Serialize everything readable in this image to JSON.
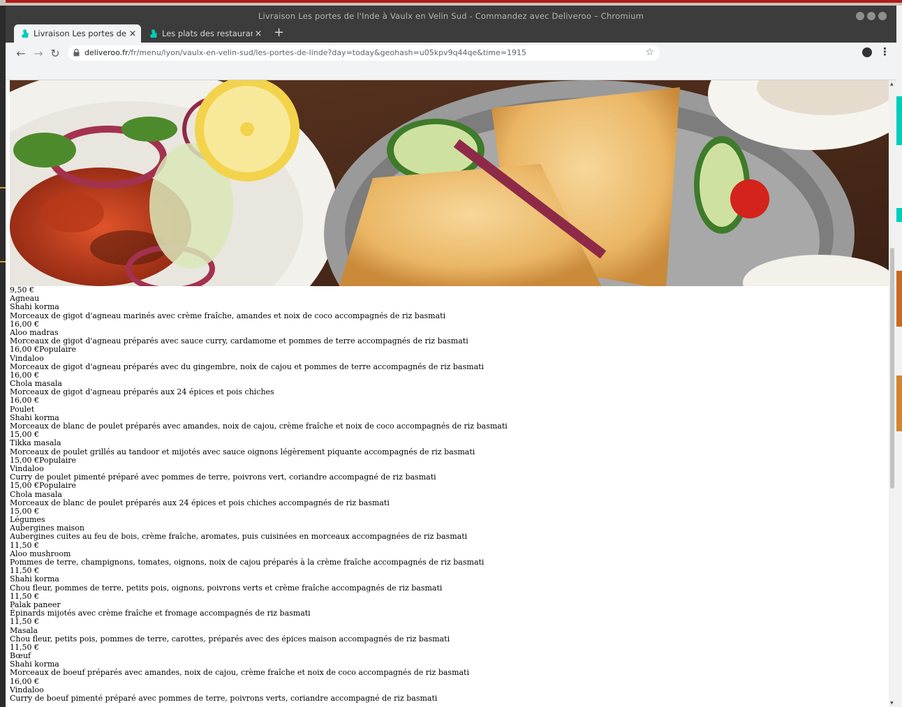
{
  "window": {
    "title": "Livraison Les portes de l'Inde à Vaulx en Velin Sud - Commandez avec Deliveroo – Chromium"
  },
  "tabs": [
    {
      "label": "Livraison Les portes de l'I",
      "close": "×"
    },
    {
      "label": "Les plats des restaurants",
      "close": "×"
    }
  ],
  "newtab_label": "+",
  "address": {
    "url_host": "deliveroo.fr",
    "url_path": "/fr/menu/lyon/vaulx-en-velin-sud/les-portes-de-linde?day=today&geohash=u05kpv9q44qe&time=1915"
  },
  "icons": {
    "back": "arrow-left-icon",
    "forward": "arrow-right-icon",
    "reload": "reload-icon",
    "lock": "lock-icon",
    "star": "star-icon",
    "account": "account-icon",
    "menu": "kebab-menu-icon",
    "favicon": "deliveroo-kangaroo-icon"
  },
  "colors": {
    "deliveroo_teal": "#00ccbc",
    "titlebar": "#3c3c3c",
    "toolbar": "#f1f3f4"
  },
  "menu_lines": [
    "9,50 €",
    "Agneau",
    "Shahi korma",
    "Morceaux de gigot d'agneau marinés avec crème fraîche, amandes et noix de coco accompagnés de riz basmati",
    "16,00 €",
    "Aloo madras",
    "Morceaux de gigot d'agneau préparés avec sauce curry, cardamome et pommes de terre accompagnés de riz basmati",
    "16,00 €Populaire",
    "Vindaloo",
    "Morceaux de gigot d'agneau préparés avec du gingembre, noix de cajou et pommes de terre accompagnés de riz basmati",
    "16,00 €",
    "Chola masala",
    "Morceaux de gigot d'agneau préparés aux 24 épices et pois chiches",
    "16,00 €",
    "Poulet",
    "Shahi korma",
    "Morceaux de blanc de poulet préparés avec amandes, noix de cajou, crème fraîche et noix de coco accompagnés de riz basmati",
    "15,00 €",
    "Tikka masala",
    "Morceaux de poulet grillés au tandoor et mijotés avec sauce oignons légèrement piquante accompagnés de riz basmati",
    "15,00 €Populaire",
    "Vindaloo",
    "Curry de poulet pimenté préparé avec pommes de terre, poivrons vert, coriandre accompagné de riz basmati",
    "15,00 €Populaire",
    "Chola masala",
    "Morceaux de blanc de poulet préparés aux 24 épices et pois chiches accompagnés de riz basmati",
    "15,00 €",
    "Légumes",
    "Aubergines maison",
    "Aubergines cuites au feu de bois, crème fraîche, aromates, puis cuisinées en morceaux accompagnées de riz basmati",
    "11,50 €",
    "Aloo mushroom",
    "Pommes de terre, champignons, tomates, oignons, noix de cajou préparés à la crème fraîche accompagnés de riz basmati",
    "11,50 €",
    "Shahi korma",
    "Chou fleur, pommes de terre, petits pois, oignons, poivrons verts et crème fraîche accompagnés de riz basmati",
    "11,50 €",
    "Palak paneer",
    "Épinards mijotés avec crème fraîche et fromage accompagnés de riz basmati",
    "11,50 €",
    "Masala",
    "Chou fleur, petits pois, pommes de terre, carottes, préparés avec des épices maison accompagnés de riz basmati",
    "11,50 €",
    "Bœuf",
    "Shahi korma",
    "Morceaux de boeuf préparés avec amandes, noix de cajou, crème fraîche et noix de coco accompagnés de riz basmati",
    "16,00 €",
    "Vindaloo",
    "Curry de boeuf pimenté préparé avec pommes de terre, poivrons verts, coriandre accompagné de riz basmati"
  ]
}
